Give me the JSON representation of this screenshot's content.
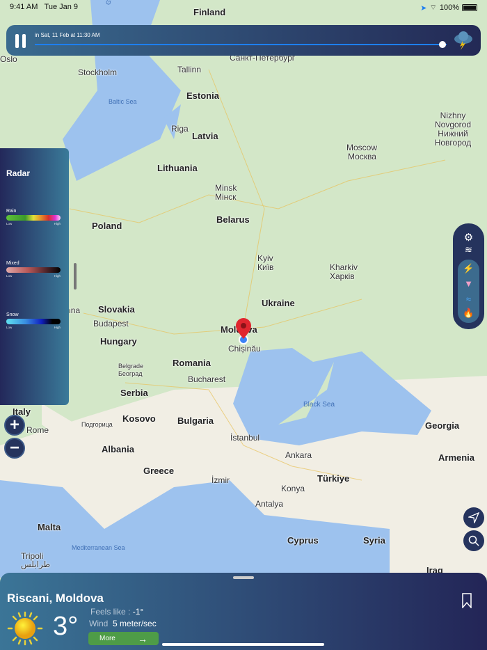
{
  "status_bar": {
    "time": "9:41 AM",
    "date": "Tue Jan 9",
    "battery": "100%"
  },
  "timeline": {
    "label": "in Sat, 11 Feb at 11:30 AM",
    "progress": 0.99,
    "weather_icon": "thunderstorm-icon"
  },
  "radar": {
    "title": "Radar",
    "legends": [
      {
        "name": "Rain",
        "low": "Low",
        "high": "High"
      },
      {
        "name": "Mixed",
        "low": "Low",
        "high": "High"
      },
      {
        "name": "Snow",
        "low": "Low",
        "high": "High"
      }
    ]
  },
  "map": {
    "labels": [
      "Finland",
      "Санкт-Петербург",
      "Stockholm",
      "Tallinn",
      "Estonia",
      "Baltic Sea",
      "Riga",
      "Latvia",
      "Lithuania",
      "Nizhny Novgorod",
      "Нижний Новгород",
      "Moscow",
      "Москва",
      "Minsk",
      "Мінск",
      "Belarus",
      "Poland",
      "Kyiv",
      "Київ",
      "Kharkiv",
      "Харків",
      "Ukraine",
      "Slovakia",
      "Budapest",
      "Hungary",
      "Moldova",
      "Chișinău",
      "Romania",
      "Belgrade",
      "Београд",
      "Bucharest",
      "Serbia",
      "Kosovo",
      "Подгорица",
      "Bulgaria",
      "Italy",
      "Rome",
      "Albania",
      "Black Sea",
      "Georgia",
      "İstanbul",
      "Ankara",
      "Armenia",
      "Greece",
      "İzmir",
      "Konya",
      "Türkiye",
      "Antalya",
      "Malta",
      "Cyprus",
      "Syria",
      "Mediterranean Sea",
      "Tripoli",
      "طرابلس",
      "Iraq",
      "Gulf of Bothnia",
      "Oslo",
      "Vienna"
    ]
  },
  "bottom_sheet": {
    "location": "Riscani, Moldova",
    "temperature": "3°",
    "feels_like_label": "Feels like :",
    "feels_like_value": "-1°",
    "wind_label": "Wind",
    "wind_value": "5 meter/sec",
    "more_label": "More",
    "condition_icon": "sun-icon"
  },
  "colors": {
    "panel_dark": "#232557",
    "panel_light": "#3b7597",
    "more_button": "#4e9c47",
    "pin": "#e0262f"
  }
}
